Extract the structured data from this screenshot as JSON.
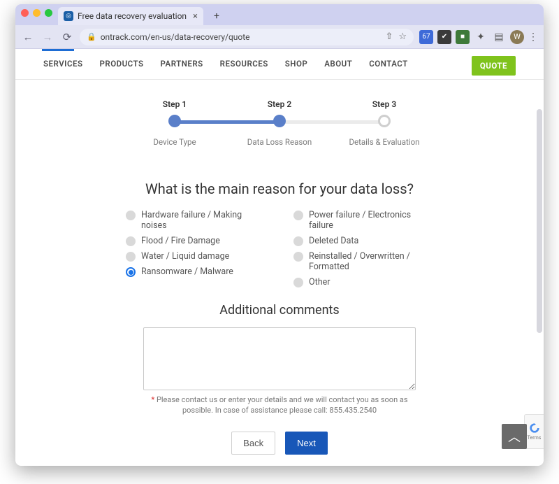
{
  "browser": {
    "tab_title": "Free data recovery evaluation",
    "url": "ontrack.com/en-us/data-recovery/quote",
    "avatar_letter": "W"
  },
  "nav": {
    "items": [
      "SERVICES",
      "PRODUCTS",
      "PARTNERS",
      "RESOURCES",
      "SHOP",
      "ABOUT",
      "CONTACT"
    ],
    "quote_label": "QUOTE"
  },
  "stepper": {
    "steps": [
      {
        "title": "Step 1",
        "label": "Device Type"
      },
      {
        "title": "Step 2",
        "label": "Data Loss Reason"
      },
      {
        "title": "Step 3",
        "label": "Details & Evaluation"
      }
    ]
  },
  "form": {
    "question": "What is the main reason for your data loss?",
    "options_left": [
      "Hardware failure / Making noises",
      "Flood / Fire Damage",
      "Water / Liquid damage",
      "Ransomware / Malware"
    ],
    "options_right": [
      "Power failure / Electronics failure",
      "Deleted Data",
      "Reinstalled / Overwritten / Formatted",
      "Other"
    ],
    "selected_option": "Ransomware / Malware",
    "comments_title": "Additional comments",
    "comments_value": "",
    "help_text": "Please contact us or enter your details and we will contact you as soon as possible. In case of assistance please call: 855.435.2540",
    "required_mark": "*",
    "back_label": "Back",
    "next_label": "Next"
  },
  "recaptcha_label": "Terms"
}
